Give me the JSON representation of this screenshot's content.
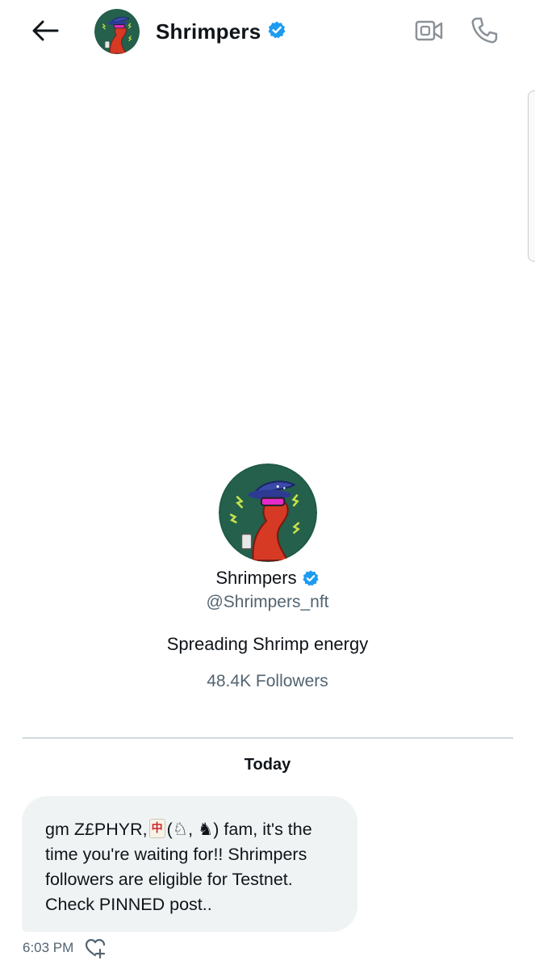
{
  "header": {
    "title": "Shrimpers",
    "back_icon": "arrow-left-icon",
    "video_icon": "video-camera-icon",
    "call_icon": "phone-icon"
  },
  "profile": {
    "name": "Shrimpers",
    "handle": "@Shrimpers_nft",
    "bio": "Spreading Shrimp energy",
    "followers": "48.4K Followers"
  },
  "conversation": {
    "date_label": "Today",
    "messages": [
      {
        "lines": [
          "gm Z£PHYR,",
          "(♘, ♞) fam, it's the",
          "time you're waiting for!! Shrimpers",
          "followers are eligible for Testnet.",
          "Check PINNED post.."
        ],
        "emoji_tile": "中",
        "time": "6:03 PM"
      }
    ]
  },
  "colors": {
    "verified_blue": "#1d9bf0",
    "secondary_text": "#536471",
    "bubble_bg": "#eff3f4",
    "avatar_bg": "#1f5a48",
    "shrimp_red": "#d63a25"
  }
}
